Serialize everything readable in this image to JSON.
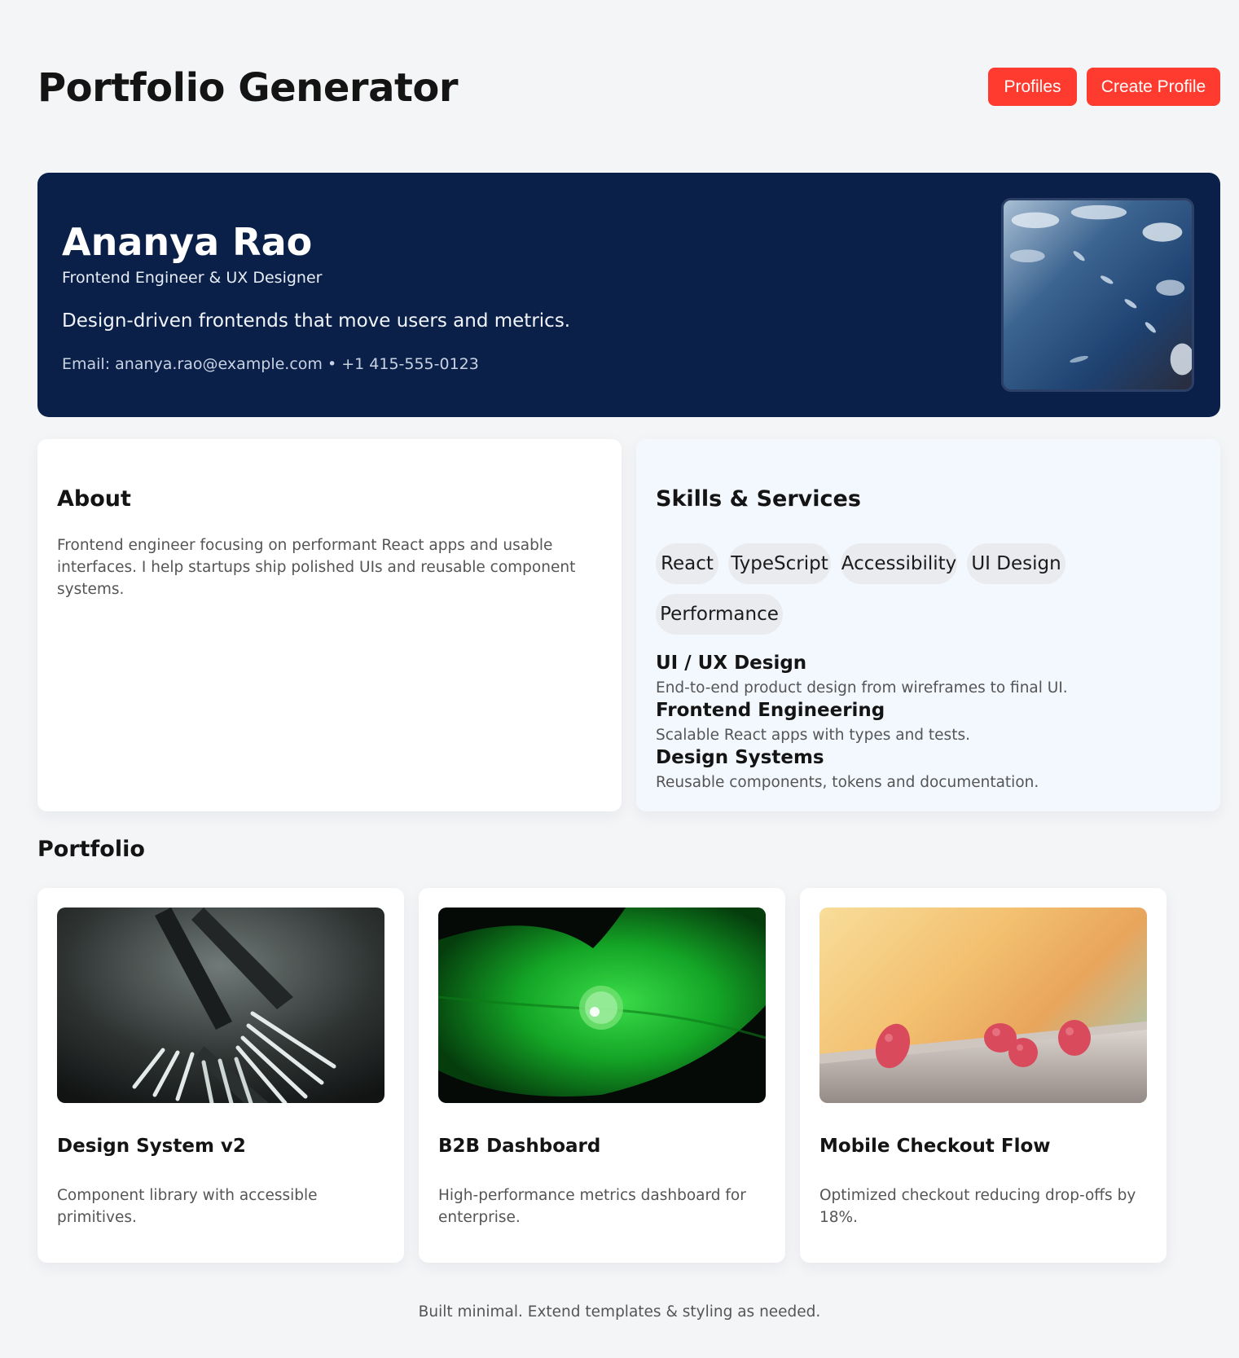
{
  "header": {
    "title": "Portfolio Generator",
    "profiles_label": "Profiles",
    "create_label": "Create Profile"
  },
  "hero": {
    "name": "Ananya Rao",
    "role": "Frontend Engineer & UX Designer",
    "tagline": "Design-driven frontends that move users and metrics.",
    "contact": "Email: ananya.rao@example.com • +1 415-555-0123"
  },
  "about": {
    "title": "About",
    "text": "Frontend engineer focusing on performant React apps and usable interfaces. I help startups ship polished UIs and reusable component systems."
  },
  "skills": {
    "title": "Skills & Services",
    "chips": [
      "React",
      "TypeScript",
      "Accessibility",
      "UI Design",
      "Performance"
    ],
    "services": [
      {
        "title": "UI / UX Design",
        "desc": "End-to-end product design from wireframes to final UI."
      },
      {
        "title": "Frontend Engineering",
        "desc": "Scalable React apps with types and tests."
      },
      {
        "title": "Design Systems",
        "desc": "Reusable components, tokens and documentation."
      }
    ]
  },
  "portfolio": {
    "heading": "Portfolio",
    "items": [
      {
        "title": "Design System v2",
        "desc": "Component library with accessible primitives."
      },
      {
        "title": "B2B Dashboard",
        "desc": "High-performance metrics dashboard for enterprise."
      },
      {
        "title": "Mobile Checkout Flow",
        "desc": "Optimized checkout reducing drop-offs by 18%."
      }
    ]
  },
  "footer": {
    "text": "Built minimal. Extend templates & styling as needed."
  },
  "colors": {
    "accent": "#ff3b2f",
    "hero_bg": "#0a2048",
    "page_bg": "#f4f5f7",
    "skills_bg": "#f3f7fe"
  }
}
